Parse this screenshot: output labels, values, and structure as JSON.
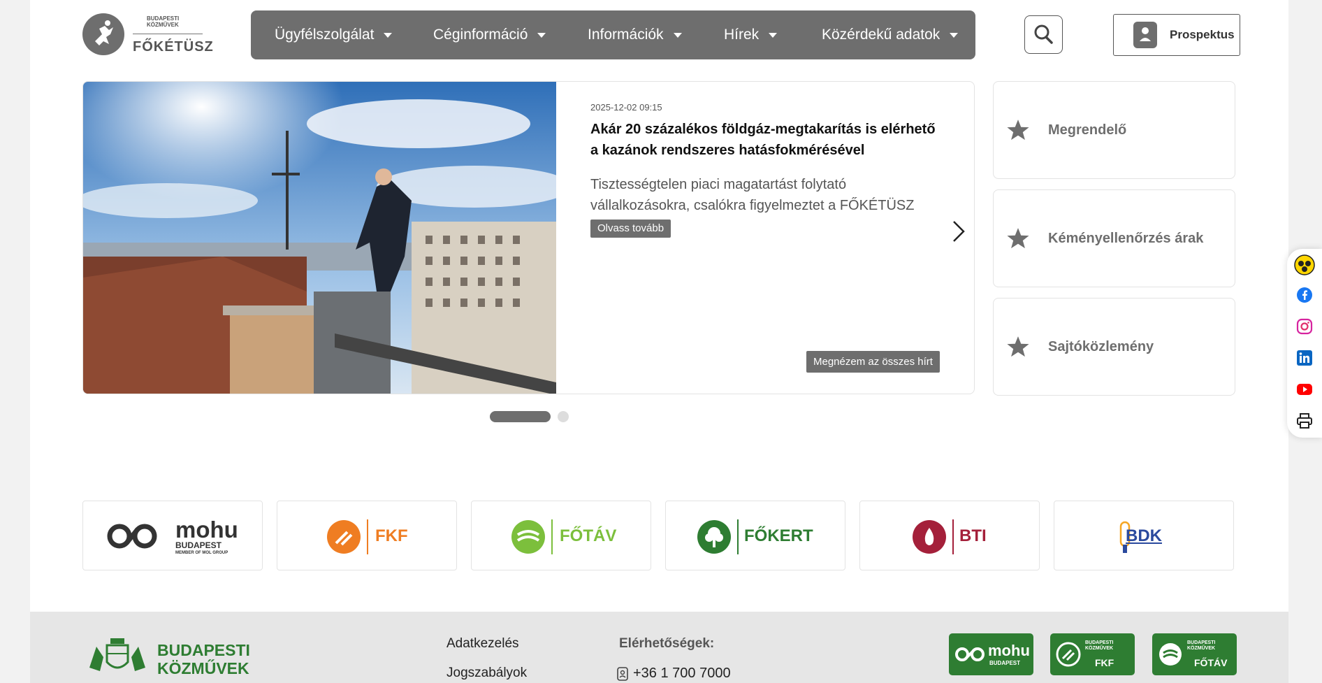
{
  "header": {
    "logo": {
      "line1": "BUDAPESTI",
      "line2": "KÖZMŰVEK",
      "brand": "FŐKÉTÜSZ"
    },
    "nav": [
      {
        "label": "Ügyfélszolgálat"
      },
      {
        "label": "Céginformáció"
      },
      {
        "label": "Információk"
      },
      {
        "label": "Hírek"
      },
      {
        "label": "Közérdekű adatok"
      }
    ],
    "prospectus_label": "Prospektus"
  },
  "news": {
    "date": "2025-12-02 09:15",
    "title": "Akár 20 százalékos földgáz-megtakarítás is elérhető a kazánok rendszeres hatásfokmérésével",
    "lead": "Tisztességtelen piaci magatartást folytató vállalkozásokra, csalókra figyelmeztet a FŐKÉTÜSZ",
    "read_more": "Olvass tovább",
    "all_news": "Megnézem az összes hírt",
    "slide_count": 2,
    "active_slide": 1
  },
  "quick_links": [
    {
      "label": "Megrendelő"
    },
    {
      "label": "Kéményellenőrzés árak"
    },
    {
      "label": "Sajtóközlemény"
    }
  ],
  "social_icons": [
    "accessibility-icon",
    "facebook-icon",
    "instagram-icon",
    "linkedin-icon",
    "youtube-icon",
    "print-icon"
  ],
  "partners": [
    {
      "name": "mohu",
      "sub": "BUDAPEST",
      "sub2": "MEMBER OF MOL GROUP",
      "color": "#333333"
    },
    {
      "name": "FKF",
      "color": "#ef7d22"
    },
    {
      "name": "FŐTÁV",
      "color": "#7cbf3c"
    },
    {
      "name": "FŐKERT",
      "color": "#2e7d32"
    },
    {
      "name": "BTI",
      "color": "#a4203a"
    },
    {
      "name": "BDK",
      "color": "#2b4a9e"
    }
  ],
  "footer": {
    "brand_line1": "BUDAPESTI",
    "brand_line2": "KÖZMŰVEK",
    "links": [
      "Adatkezelés",
      "Jogszabályok"
    ],
    "contact_heading": "Elérhetőségek:",
    "phone": "+36 1 700 7000",
    "logos": [
      {
        "name": "mohu",
        "sub": "BUDAPEST"
      },
      {
        "name": "FKF",
        "sub": "BUDAPESTI KÖZMŰVEK"
      },
      {
        "name": "FŐTÁV",
        "sub": "BUDAPESTI KÖZMŰVEK"
      }
    ]
  },
  "colors": {
    "accent_gray": "#6e6e6e",
    "footer_green": "#2e7d32"
  }
}
